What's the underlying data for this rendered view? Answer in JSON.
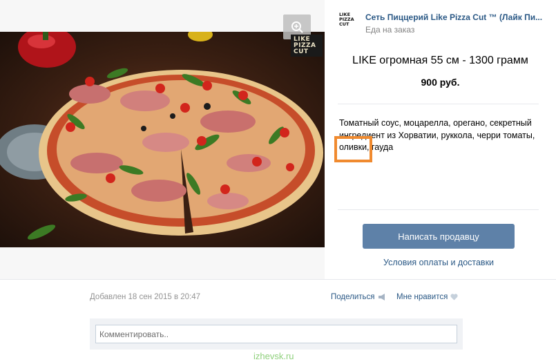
{
  "shop": {
    "name": "Сеть Пиццерий Like Pizza Cut ™ (Лайк Пи...",
    "status": "Еда на заказ",
    "logo_text": "LIKE PIZZA CUT"
  },
  "photo": {
    "logo_text": "LIKE PIZZA CUT",
    "zoom_icon": "zoom-in-icon"
  },
  "product": {
    "title": "LIKE огромная 55 см - 1300 грамм",
    "price": "900 руб.",
    "description": "Томатный соус, моцарелла, орегано, секретный ингредиент из Хорватии, руккола, черри томаты, оливки, гауда"
  },
  "actions": {
    "write_seller": "Написать продавцу",
    "terms": "Условия оплаты и доставки"
  },
  "meta": {
    "added": "Добавлен 18 сен 2015 в 20:47",
    "share": "Поделиться",
    "like": "Мне нравится"
  },
  "comment": {
    "placeholder": "Комментировать.."
  },
  "watermark": "izhevsk.ru",
  "colors": {
    "link": "#2a5885",
    "button": "#5e81a8",
    "highlight": "#f08a2f",
    "watermark": "#8fd07c"
  }
}
